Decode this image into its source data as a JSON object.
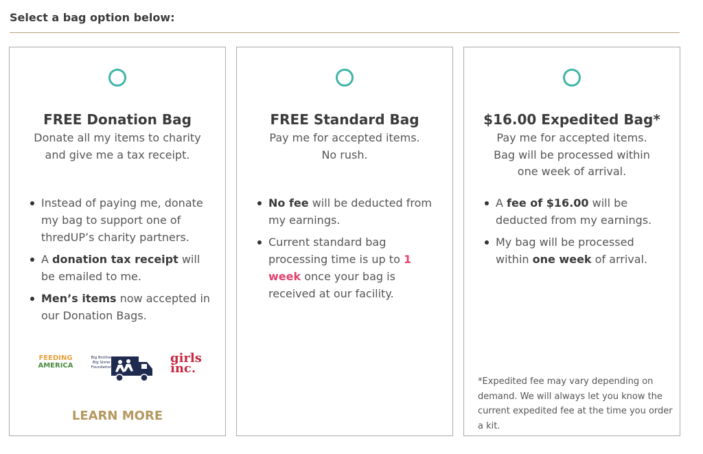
{
  "heading": "Select a bag option below:",
  "colors": {
    "accent_radio": "#3fb5a8",
    "rule": "#b9a37a",
    "link": "#b4985f",
    "highlight": "#e0436e"
  },
  "cards": [
    {
      "title": "FREE Donation Bag",
      "subtitle": [
        "Donate all my items to charity",
        "and give me a tax receipt."
      ],
      "bullets": [
        {
          "pre": "Instead of paying me, donate my bag to support one of thredUP’s charity partners."
        },
        {
          "pre": "A ",
          "bold": "donation tax receipt",
          "post": " will be emailed to me."
        },
        {
          "bold": "Men’s items",
          "post": " now accepted in our Donation Bags."
        }
      ],
      "logos": {
        "feeding_line1": "FEEDING",
        "feeding_line2": "AMERICA",
        "bbbs_text": [
          "Big Brother",
          "Big Sister",
          "Foundation"
        ],
        "girls_line1": "girls",
        "girls_line2": "inc."
      },
      "learn_more": "LEARN MORE"
    },
    {
      "title": "FREE Standard Bag",
      "subtitle": [
        "Pay me for accepted items.",
        "No rush."
      ],
      "bullets": [
        {
          "bold": "No fee",
          "post": " will be deducted from my earnings."
        },
        {
          "pre": "Current standard bag processing time is up to ",
          "highlight": "1 week",
          "post": " once your bag is received at our facility."
        }
      ]
    },
    {
      "title": "$16.00 Expedited Bag*",
      "subtitle": [
        "Pay me for accepted items.",
        "Bag will be processed within",
        "one week of arrival."
      ],
      "bullets": [
        {
          "pre": "A ",
          "bold": "fee of $16.00",
          "post": " will be deducted from my earnings."
        },
        {
          "pre": "My bag will be processed within ",
          "bold": "one week",
          "post": " of arrival."
        }
      ],
      "footnote": "*Expedited fee may vary depending on demand. We will always let you know the current expedited fee at the time you order a kit."
    }
  ]
}
